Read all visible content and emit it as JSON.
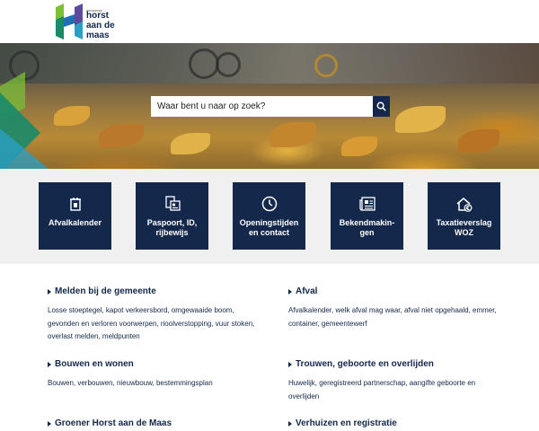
{
  "logo": {
    "small": "gemeente",
    "line1": "horst",
    "line2": "aan de",
    "line3": "maas"
  },
  "search": {
    "placeholder": "Waar bent u naar op zoek?"
  },
  "tiles": [
    {
      "label": "Afvalkalender",
      "icon": "calendar-bin-icon"
    },
    {
      "label": "Paspoort, ID, rijbewijs",
      "icon": "id-card-icon"
    },
    {
      "label": "Openingstijden en contact",
      "icon": "clock-icon"
    },
    {
      "label": "Bekendmakin-gen",
      "icon": "newspaper-icon"
    },
    {
      "label": "Taxatieverslag WOZ",
      "icon": "house-euro-icon"
    }
  ],
  "sections": [
    {
      "title": "Melden bij de gemeente",
      "desc": "Losse stoeptegel, kapot verkeersbord, omgewaaide boom, gevonden en verloren voorwerpen, rioolverstopping, vuur stoken, overlast melden, meldpunten"
    },
    {
      "title": "Afval",
      "desc": "Afvalkalender, welk afval mag waar, afval niet opgehaald, emmer, container, gemeentewerf"
    },
    {
      "title": "Bouwen en wonen",
      "desc": "Bouwen, verbouwen, nieuwbouw, bestemmingsplan"
    },
    {
      "title": "Trouwen, geboorte en overlijden",
      "desc": "Huwelijk, geregistreerd partnerschap, aangifte geboorte en overlijden"
    },
    {
      "title": "Groener Horst aan de Maas",
      "desc": ""
    },
    {
      "title": "Verhuizen en registratie",
      "desc": ""
    }
  ],
  "colors": {
    "navy": "#13284b",
    "band": "#f0f0f0",
    "logo_green": "#7bbf3a",
    "logo_teal": "#1a8a6a",
    "logo_blue": "#2aa0c8"
  }
}
